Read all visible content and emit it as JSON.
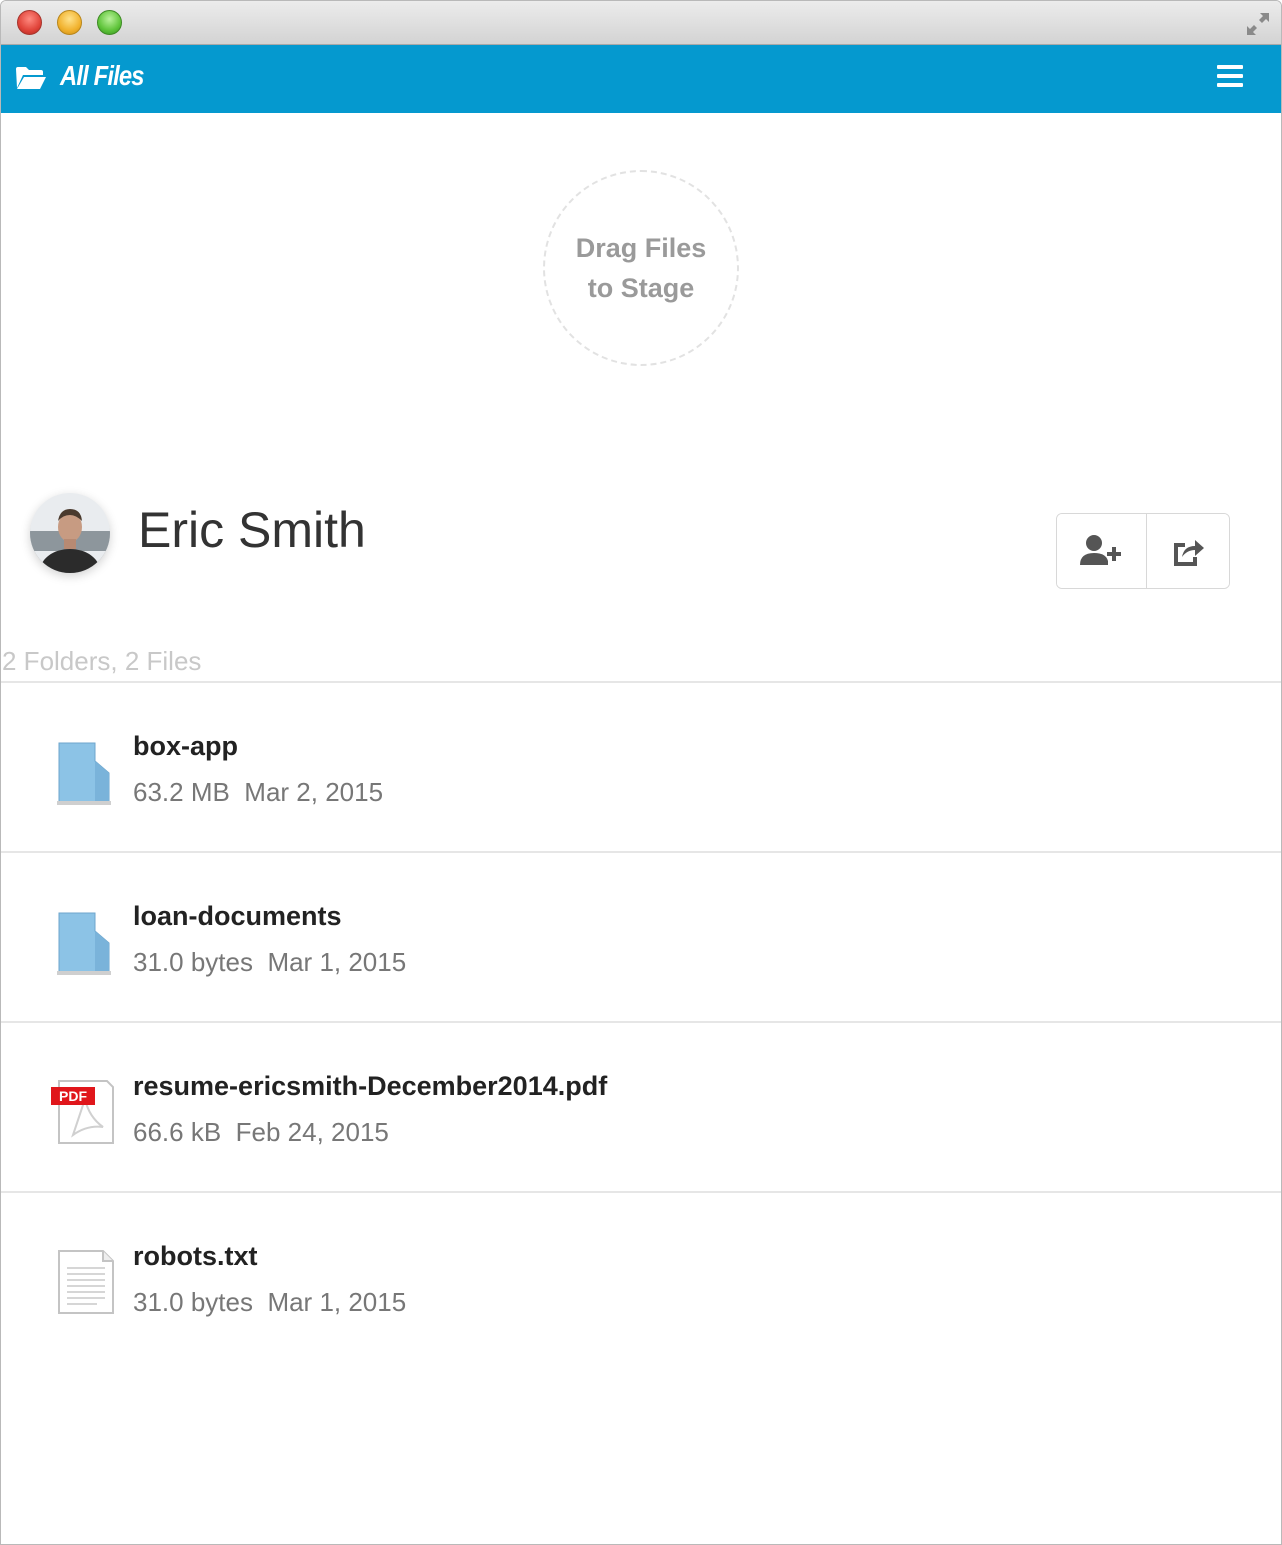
{
  "appbar": {
    "title": "All Files"
  },
  "dropzone": {
    "line1": "Drag Files",
    "line2": "to Stage"
  },
  "user": {
    "name": "Eric Smith"
  },
  "actions": {
    "add_user_icon": "user-plus-icon",
    "share_icon": "share-icon"
  },
  "summary": "2 Folders, 2 Files",
  "files": [
    {
      "name": "box-app",
      "size": "63.2 MB",
      "date": "Mar 2, 2015",
      "kind": "folder"
    },
    {
      "name": "loan-documents",
      "size": "31.0 bytes",
      "date": "Mar 1, 2015",
      "kind": "folder"
    },
    {
      "name": "resume-ericsmith-December2014.pdf",
      "size": "66.6 kB",
      "date": "Feb 24, 2015",
      "kind": "pdf"
    },
    {
      "name": "robots.txt",
      "size": "31.0 bytes",
      "date": "Mar 1, 2015",
      "kind": "text"
    }
  ],
  "colors": {
    "appbar": "#0599cf",
    "folder": "#8cc3e6",
    "pdf_badge": "#e0161b"
  }
}
